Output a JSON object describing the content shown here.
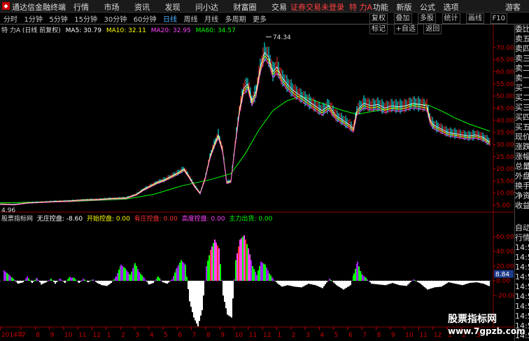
{
  "titlebar": {
    "app_name": "通达信金融终端",
    "menu": [
      "行情",
      "市场",
      "资讯",
      "发现",
      "问小达",
      "财富圈",
      "交易"
    ],
    "notice": "证券交易未登录",
    "stock": "特 力A",
    "right_menu": [
      "功能",
      "新版",
      "公式",
      "选项"
    ],
    "guest": "游客"
  },
  "toolbar": {
    "periods": [
      "分时",
      "1分钟",
      "5分钟",
      "15分钟",
      "30分钟",
      "60分钟",
      "日线",
      "周线",
      "月线",
      "多周期",
      "更多"
    ],
    "active_period": "日线",
    "tools": [
      "复权",
      "叠加",
      "多股",
      "统计",
      "画线",
      "F10",
      "标记",
      "+自选",
      "返回"
    ]
  },
  "legend": {
    "title": "特 力A (日线 前复权)",
    "ma5": "MA5: 30.79",
    "ma10": "MA10: 32.11",
    "ma20": "MA20: 32.95",
    "ma60": "MA60: 34.57"
  },
  "indicator": {
    "title": "股票指标网",
    "wuzhuang": "无庄控盘: -8.60",
    "kaishi": "开始控盘: 0.00",
    "youzhuang": "有庄控盘: 0.00",
    "gaodu": "高度控盘: 0.00",
    "zhuli": "主力出货: 0.00",
    "value_tag": "8.84"
  },
  "price_axis": [
    "70.00",
    "65.00",
    "60.00",
    "55.00",
    "50.00",
    "45.00",
    "40.00",
    "35.00",
    "30.00",
    "25.00",
    "20.00",
    "15.00",
    "10.00",
    "5.00"
  ],
  "ind_axis": [
    "60.00",
    "40.00",
    "20.00",
    "0.00",
    "-20.00"
  ],
  "annotations": {
    "high": "74.34",
    "low": "4.96"
  },
  "date_axis": [
    "2014年",
    "7",
    "8",
    "9",
    "10",
    "11",
    "12",
    "1",
    "2",
    "3",
    "4",
    "5",
    "6",
    "7",
    "8",
    "9",
    "10",
    "11",
    "12",
    "1",
    "2",
    "3",
    "4",
    "5",
    "6",
    "7",
    "8",
    "9",
    "10",
    "11",
    "12",
    "1",
    "2",
    "3"
  ],
  "right_panel": [
    "委比",
    "卖五",
    "卖四",
    "卖三",
    "卖二",
    "卖一",
    "买一",
    "买二",
    "买三",
    "买四",
    "买五",
    "现价",
    "涨跌",
    "涨幅",
    "总量",
    "外盘",
    "换手",
    "净资",
    "收益",
    "自动",
    "行情",
    "14:5",
    "14:5",
    "14:5",
    "14:5",
    "14:5",
    "14:5",
    "14:5",
    "14:5",
    "14:5",
    "14:5"
  ],
  "watermark": {
    "line1": "股票指标网",
    "line2": "www.7gpzb.com"
  },
  "colors": {
    "ma5": "#ffffff",
    "ma10": "#ffff00",
    "ma20": "#ff44ff",
    "ma60": "#00ff00",
    "up": "#ff3030",
    "down": "#00ffff",
    "notice": "#ff4040"
  },
  "chart_data": {
    "type": "line",
    "x_label_note": "",
    "price_series": [
      [
        0,
        5.5
      ],
      [
        20,
        5.3
      ],
      [
        40,
        6.0
      ],
      [
        60,
        6.3
      ],
      [
        80,
        6.6
      ],
      [
        100,
        6.8
      ],
      [
        120,
        7.2
      ],
      [
        140,
        7.4
      ],
      [
        160,
        7.8
      ],
      [
        180,
        8.0
      ],
      [
        195,
        9.5
      ],
      [
        205,
        11.5
      ],
      [
        215,
        13.0
      ],
      [
        225,
        14.5
      ],
      [
        235,
        15.5
      ],
      [
        245,
        17.0
      ],
      [
        255,
        18.5
      ],
      [
        263,
        20.0
      ],
      [
        270,
        17.0
      ],
      [
        278,
        13.0
      ],
      [
        286,
        10.0
      ],
      [
        293,
        16.0
      ],
      [
        300,
        25.0
      ],
      [
        306,
        30.0
      ],
      [
        312,
        34.0
      ],
      [
        318,
        28.0
      ],
      [
        324,
        14.5
      ],
      [
        330,
        15.0
      ],
      [
        336,
        30.0
      ],
      [
        342,
        44.0
      ],
      [
        348,
        53.0
      ],
      [
        354,
        55.0
      ],
      [
        360,
        48.0
      ],
      [
        366,
        52.0
      ],
      [
        372,
        62.0
      ],
      [
        378,
        68.0
      ],
      [
        384,
        66.0
      ],
      [
        390,
        60.0
      ],
      [
        396,
        62.0
      ],
      [
        402,
        58.0
      ],
      [
        410,
        55.0
      ],
      [
        420,
        52.0
      ],
      [
        430,
        50.0
      ],
      [
        440,
        48.0
      ],
      [
        450,
        46.0
      ],
      [
        460,
        44.0
      ],
      [
        470,
        46.0
      ],
      [
        480,
        42.0
      ],
      [
        490,
        40.0
      ],
      [
        500,
        38.0
      ],
      [
        505,
        36.5
      ],
      [
        510,
        44.0
      ],
      [
        520,
        47.0
      ],
      [
        530,
        46.0
      ],
      [
        540,
        46.5
      ],
      [
        550,
        45.0
      ],
      [
        560,
        46.0
      ],
      [
        570,
        45.5
      ],
      [
        580,
        46.0
      ],
      [
        590,
        47.0
      ],
      [
        600,
        46.5
      ],
      [
        610,
        46.0
      ],
      [
        615,
        40.0
      ],
      [
        620,
        38.0
      ],
      [
        630,
        36.5
      ],
      [
        640,
        35.0
      ],
      [
        650,
        34.5
      ],
      [
        660,
        34.0
      ],
      [
        670,
        33.5
      ],
      [
        680,
        34.0
      ],
      [
        690,
        33.0
      ],
      [
        700,
        31.0
      ]
    ],
    "ma60_series": [
      [
        0,
        6.0
      ],
      [
        100,
        6.5
      ],
      [
        180,
        7.5
      ],
      [
        220,
        9.5
      ],
      [
        260,
        13.0
      ],
      [
        300,
        15.5
      ],
      [
        330,
        18.0
      ],
      [
        350,
        26.0
      ],
      [
        370,
        36.0
      ],
      [
        390,
        44.0
      ],
      [
        410,
        48.0
      ],
      [
        430,
        50.0
      ],
      [
        450,
        48.0
      ],
      [
        470,
        46.0
      ],
      [
        490,
        44.0
      ],
      [
        510,
        42.5
      ],
      [
        530,
        43.5
      ],
      [
        550,
        44.5
      ],
      [
        570,
        45.5
      ],
      [
        590,
        46.5
      ],
      [
        610,
        46.5
      ],
      [
        630,
        44.0
      ],
      [
        650,
        41.0
      ],
      [
        670,
        38.5
      ],
      [
        690,
        36.5
      ],
      [
        700,
        35.5
      ]
    ],
    "ind_bars": [
      [
        5,
        14
      ],
      [
        12,
        8
      ],
      [
        18,
        3
      ],
      [
        25,
        -4
      ],
      [
        32,
        -2
      ],
      [
        38,
        6
      ],
      [
        45,
        -3
      ],
      [
        52,
        4
      ],
      [
        58,
        -5
      ],
      [
        65,
        -2
      ],
      [
        72,
        3
      ],
      [
        78,
        -4
      ],
      [
        85,
        3
      ],
      [
        92,
        -3
      ],
      [
        98,
        5
      ],
      [
        105,
        4
      ],
      [
        112,
        -3
      ],
      [
        118,
        3
      ],
      [
        125,
        -2
      ],
      [
        132,
        2
      ],
      [
        138,
        -3
      ],
      [
        145,
        -6
      ],
      [
        152,
        -7
      ],
      [
        158,
        -3
      ],
      [
        165,
        6
      ],
      [
        172,
        22
      ],
      [
        178,
        17
      ],
      [
        185,
        8
      ],
      [
        192,
        24
      ],
      [
        198,
        12
      ],
      [
        205,
        4
      ],
      [
        212,
        -5
      ],
      [
        218,
        -3
      ],
      [
        225,
        6
      ],
      [
        232,
        -2
      ],
      [
        238,
        -4
      ],
      [
        245,
        2
      ],
      [
        252,
        18
      ],
      [
        258,
        28
      ],
      [
        264,
        22
      ],
      [
        270,
        -28
      ],
      [
        276,
        -50
      ],
      [
        282,
        -62
      ],
      [
        288,
        -40
      ],
      [
        294,
        20
      ],
      [
        300,
        42
      ],
      [
        306,
        56
      ],
      [
        312,
        44
      ],
      [
        318,
        -20
      ],
      [
        324,
        -46
      ],
      [
        330,
        -50
      ],
      [
        336,
        28
      ],
      [
        342,
        56
      ],
      [
        348,
        62
      ],
      [
        354,
        44
      ],
      [
        360,
        20
      ],
      [
        366,
        8
      ],
      [
        372,
        26
      ],
      [
        378,
        22
      ],
      [
        384,
        10
      ],
      [
        390,
        2
      ],
      [
        396,
        -4
      ],
      [
        402,
        -8
      ],
      [
        410,
        -6
      ],
      [
        420,
        -8
      ],
      [
        430,
        -9
      ],
      [
        440,
        -4
      ],
      [
        450,
        -6
      ],
      [
        460,
        -10
      ],
      [
        470,
        3
      ],
      [
        480,
        -6
      ],
      [
        490,
        -12
      ],
      [
        500,
        -6
      ],
      [
        505,
        10
      ],
      [
        510,
        26
      ],
      [
        515,
        10
      ],
      [
        522,
        4
      ],
      [
        530,
        -4
      ],
      [
        540,
        -5
      ],
      [
        550,
        -6
      ],
      [
        560,
        -3
      ],
      [
        570,
        -6
      ],
      [
        580,
        -7
      ],
      [
        590,
        2
      ],
      [
        600,
        -4
      ],
      [
        610,
        -12
      ],
      [
        620,
        -9
      ],
      [
        630,
        -8
      ],
      [
        640,
        -2
      ],
      [
        650,
        -4
      ],
      [
        660,
        -6
      ],
      [
        670,
        -3
      ],
      [
        680,
        -2
      ],
      [
        690,
        -4
      ],
      [
        700,
        -8
      ]
    ]
  }
}
